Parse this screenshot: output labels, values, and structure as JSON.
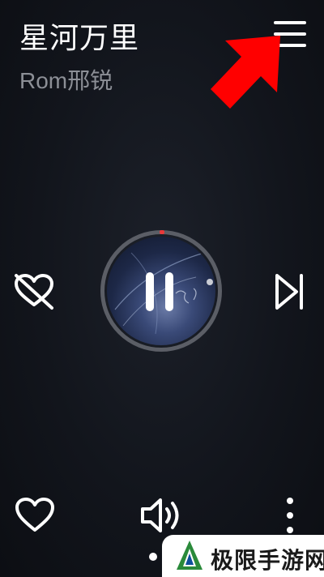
{
  "song": {
    "title": "星河万里",
    "artist": "Rom邢锐"
  },
  "icons": {
    "menu": "menu-icon",
    "arrow": "red-arrow-annotation",
    "dislike": "heart-off-icon",
    "next": "skip-next-icon",
    "play_state": "pause-icon",
    "like": "heart-icon",
    "volume": "volume-icon",
    "more": "more-vertical-icon"
  },
  "player": {
    "progress_indicator_color": "#e8393a"
  },
  "watermark": {
    "text": "极限手游网"
  },
  "colors": {
    "background": "#12151c",
    "arrow": "#ff0000",
    "artist_text": "#8c8f96"
  }
}
